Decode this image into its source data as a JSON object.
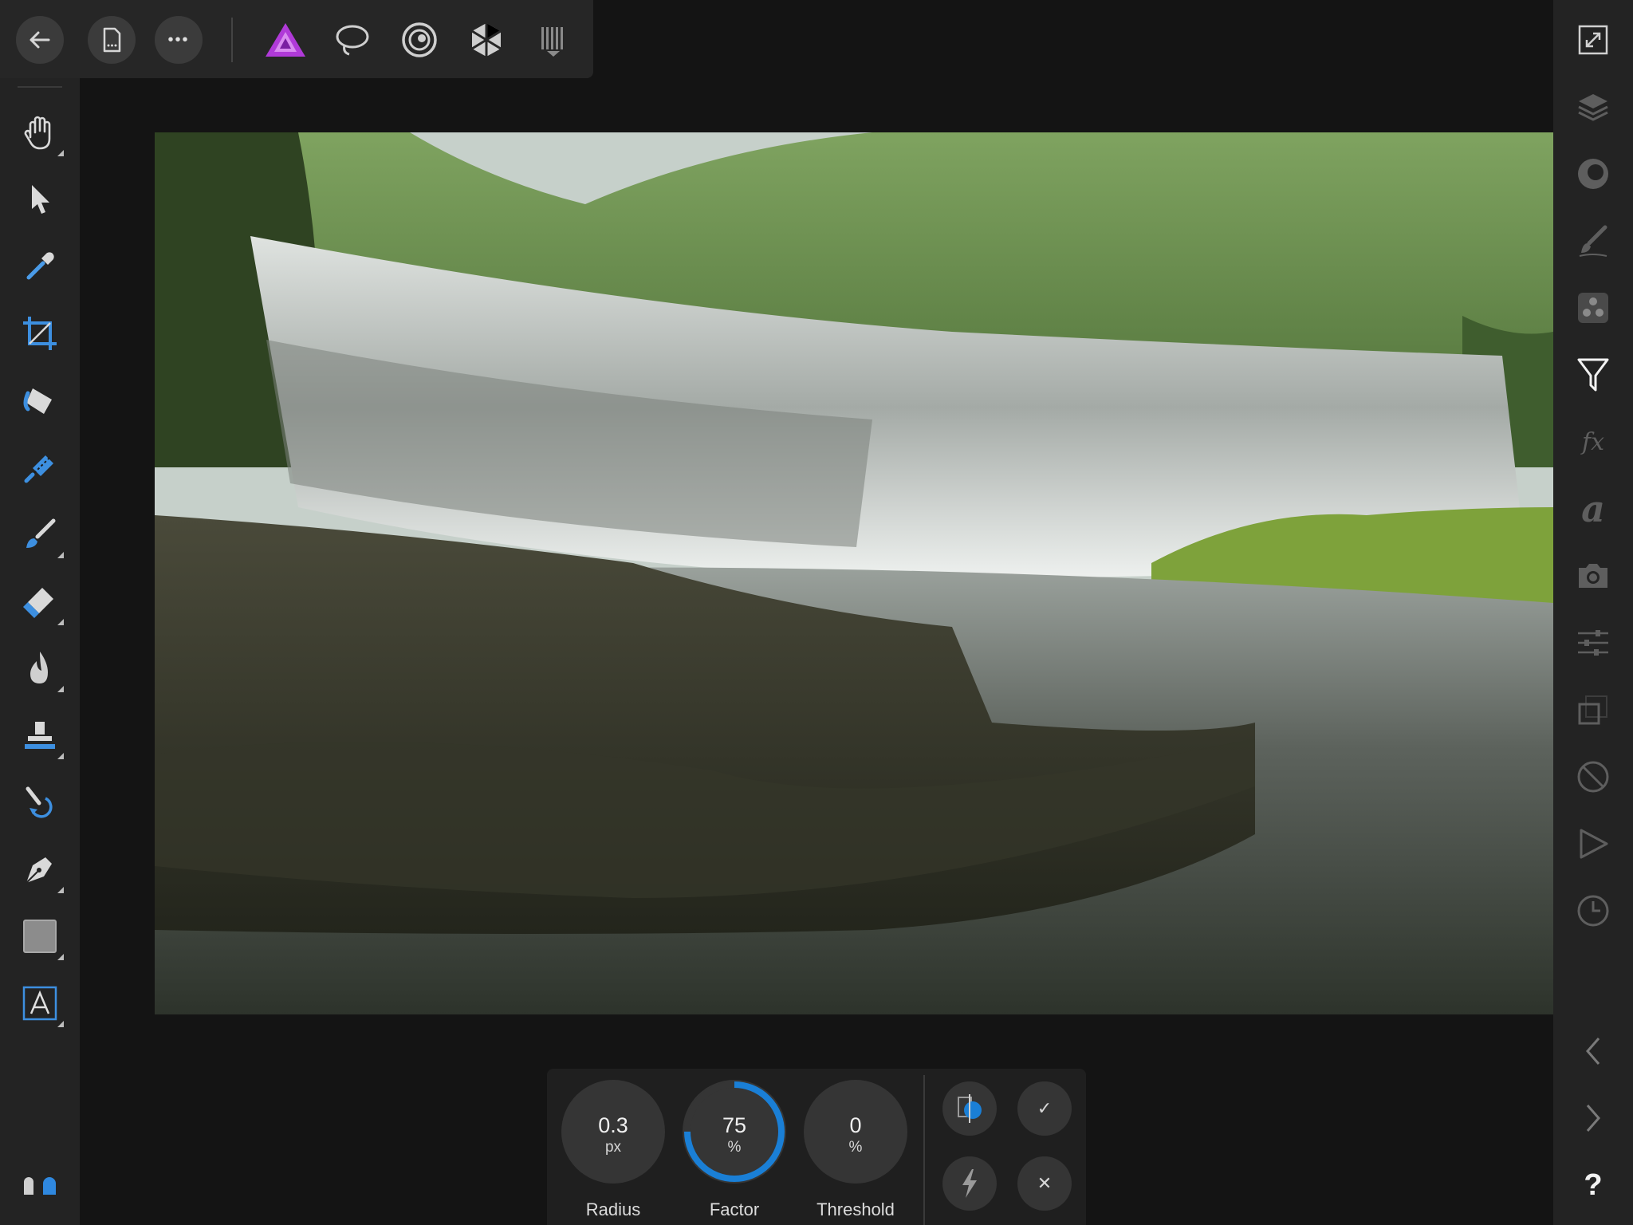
{
  "toolbar": {
    "back": {
      "icon": "back-arrow-icon",
      "interactable": true
    },
    "document": {
      "icon": "document-icon",
      "interactable": true
    },
    "more": {
      "icon": "ellipsis-icon",
      "glyph": "•••",
      "interactable": true
    },
    "personas": [
      {
        "name": "photo-persona-icon",
        "active": true,
        "color": "#b03ad8"
      },
      {
        "name": "liquify-persona-icon",
        "active": false
      },
      {
        "name": "develop-persona-icon",
        "active": false
      },
      {
        "name": "tone-mapping-persona-icon",
        "active": false
      },
      {
        "name": "export-persona-icon",
        "active": false
      }
    ]
  },
  "left_tools": [
    "view-tool-icon",
    "move-tool-icon",
    "color-picker-tool-icon",
    "crop-tool-icon",
    "flood-fill-tool-icon",
    "selection-brush-tool-icon",
    "paint-brush-tool-icon",
    "erase-brush-tool-icon",
    "burn-brush-tool-icon",
    "clone-brush-tool-icon",
    "undo-brush-tool-icon",
    "pen-tool-icon",
    "rectangle-tool-icon",
    "text-tool-icon"
  ],
  "right_studios": [
    "fullscreen-icon",
    "layers-icon",
    "adjustments-icon",
    "brushes-icon",
    "channels-icon",
    "filters-icon",
    "effects-icon",
    "text-styles-icon",
    "snapshots-icon",
    "transform-icon",
    "navigator-icon",
    "guides-icon",
    "macros-icon",
    "history-icon"
  ],
  "right_nav": {
    "back": "chevron-left-icon",
    "forward": "chevron-right-icon",
    "help": "?"
  },
  "filter_panel": {
    "filter_name_hidden": true,
    "radius": {
      "value": "0.3",
      "unit": "px",
      "label": "Radius"
    },
    "factor": {
      "value": "75",
      "unit": "%",
      "label": "Factor",
      "level": 0.75,
      "color": "#1a7fd6"
    },
    "threshold": {
      "value": "0",
      "unit": "%",
      "label": "Threshold"
    },
    "actions": {
      "preview": "split-preview-icon",
      "apply": "✓",
      "reset": "lightning-icon",
      "cancel": "✕"
    }
  },
  "canvas": {
    "description_hidden": true
  },
  "assistant": {
    "icon": "assistant-icon"
  }
}
